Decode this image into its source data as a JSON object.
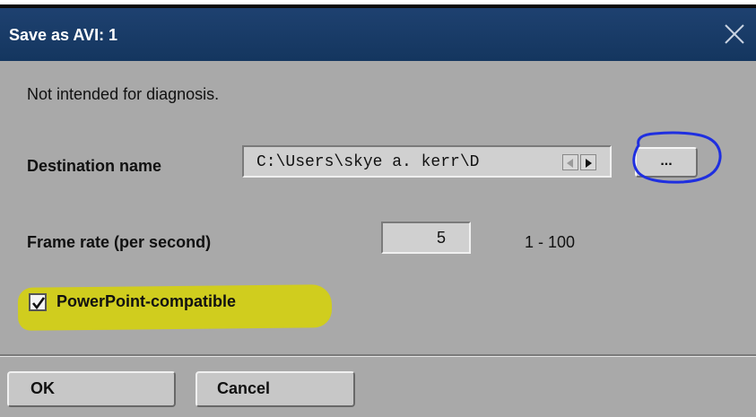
{
  "window": {
    "title": "Save as AVI: 1",
    "close_icon": "close-icon"
  },
  "notice": "Not intended for diagnosis.",
  "destination": {
    "label": "Destination name",
    "value": "C:\\Users\\skye a. kerr\\D",
    "browse_label": "...",
    "scroll_left_icon": "scroll-left-icon",
    "scroll_right_icon": "scroll-right-icon"
  },
  "frame_rate": {
    "label": "Frame rate (per second)",
    "value": "5",
    "range": "1 - 100"
  },
  "powerpoint": {
    "label": "PowerPoint-compatible",
    "checked": true
  },
  "buttons": {
    "ok": "OK",
    "cancel": "Cancel"
  },
  "colors": {
    "titlebar": "#1e4170",
    "dialog_bg": "#a9a9a9",
    "highlight": "#d2cf16",
    "annotation": "#1f2fe0"
  }
}
